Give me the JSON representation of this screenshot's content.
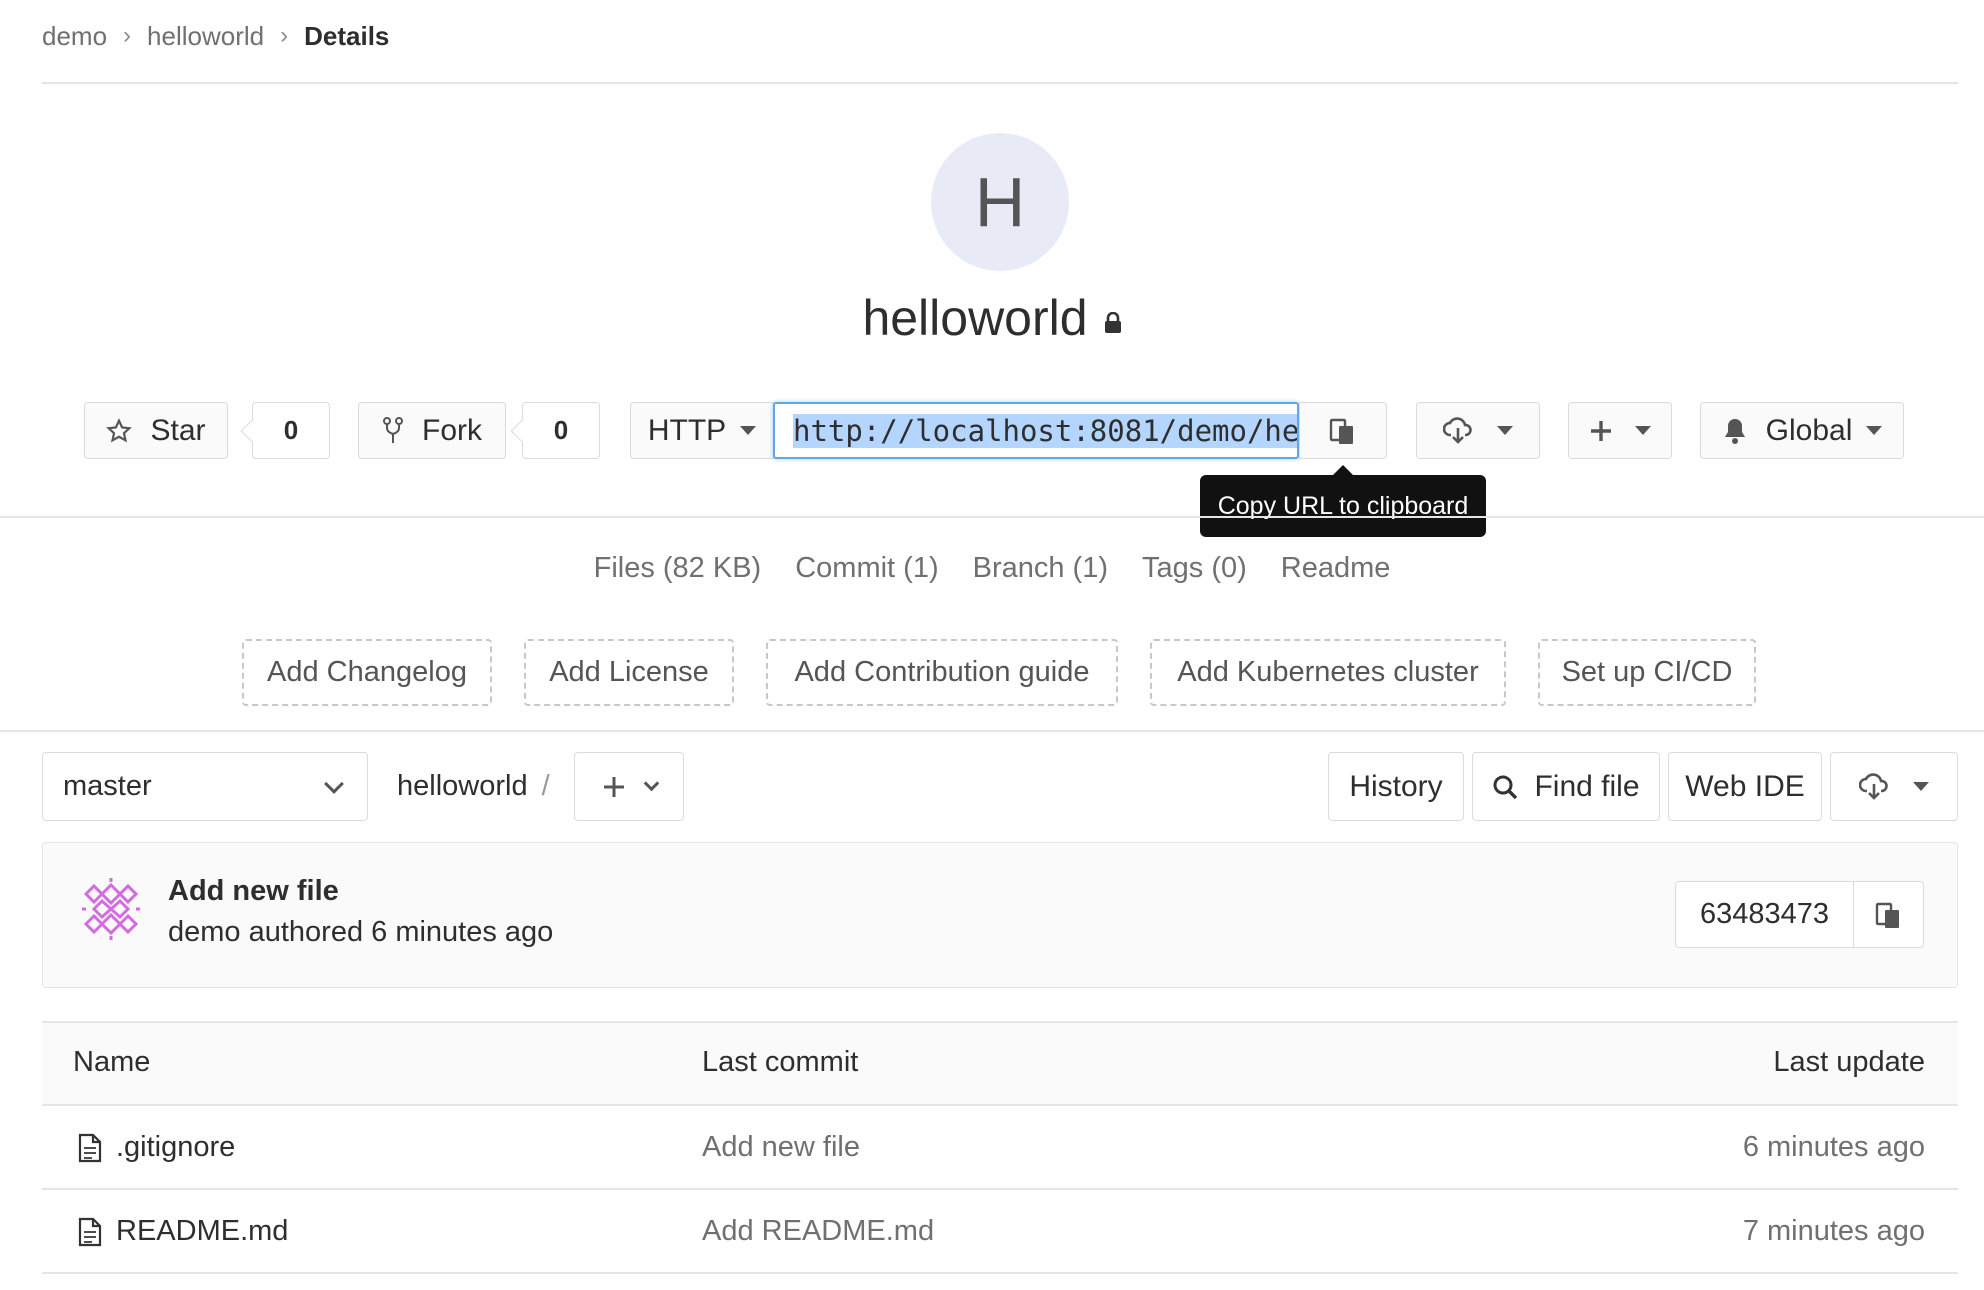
{
  "breadcrumb": {
    "items": [
      "demo",
      "helloworld"
    ],
    "current": "Details"
  },
  "project": {
    "avatar_letter": "H",
    "name": "helloworld"
  },
  "actions": {
    "star_label": "Star",
    "star_count": "0",
    "fork_label": "Fork",
    "fork_count": "0",
    "protocol": "HTTP",
    "clone_url": "http://localhost:8081/demo/he",
    "tooltip": "Copy URL to clipboard",
    "notification_level": "Global"
  },
  "stats": [
    "Files (82 KB)",
    "Commit (1)",
    "Branch (1)",
    "Tags (0)",
    "Readme"
  ],
  "suggestions": [
    "Add Changelog",
    "Add License",
    "Add Contribution guide",
    "Add Kubernetes cluster",
    "Set up CI/CD"
  ],
  "tree": {
    "branch": "master",
    "path": "helloworld",
    "path_sep": "/",
    "history_label": "History",
    "find_file_label": "Find file",
    "web_ide_label": "Web IDE"
  },
  "last_commit": {
    "title": "Add new file",
    "meta": "demo authored 6 minutes ago",
    "sha": "63483473"
  },
  "files": {
    "headers": {
      "name": "Name",
      "last_commit": "Last commit",
      "last_update": "Last update"
    },
    "rows": [
      {
        "name": ".gitignore",
        "commit": "Add new file",
        "updated": "6 minutes ago"
      },
      {
        "name": "README.md",
        "commit": "Add README.md",
        "updated": "7 minutes ago"
      }
    ]
  },
  "colors": {
    "accent": "#63a6e9",
    "avatar_bg": "#e8eaf6",
    "identicon": "#d26ce0"
  }
}
